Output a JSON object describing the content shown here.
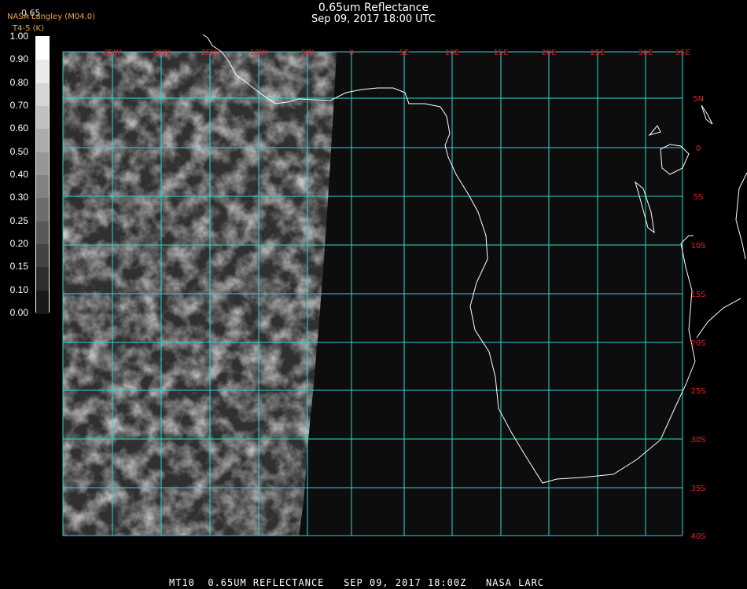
{
  "title": "0.65um Reflectance",
  "subtitle": "Sep 09, 2017 18:00 UTC",
  "credit": "NASA Langley (M04.0)",
  "credit_line2": "T4-5 (K)",
  "colorbar_header": "0.65",
  "colorbar_ticks": [
    "1.00",
    "0.90",
    "0.80",
    "0.70",
    "0.60",
    "0.50",
    "0.40",
    "0.30",
    "0.25",
    "0.20",
    "0.15",
    "0.10",
    "0.00"
  ],
  "lon_labels": [
    "35W",
    "30W",
    "25W",
    "10W",
    "5W",
    "0",
    "5E",
    "10E",
    "15E",
    "20E",
    "25E",
    "30E",
    "35E"
  ],
  "lat_labels": [
    "5N",
    "0",
    "5S",
    "10S",
    "15S",
    "20S",
    "25S",
    "30S",
    "35S",
    "40S"
  ],
  "footer": "MT10  0.65UM REFLECTANCE   SEP 09, 2017 18:00Z   NASA LARC",
  "colors": {
    "grid": "#2fd6d6",
    "grid_label": "#e02020",
    "coast": "#ffffff",
    "credit": "#f2a33a"
  }
}
